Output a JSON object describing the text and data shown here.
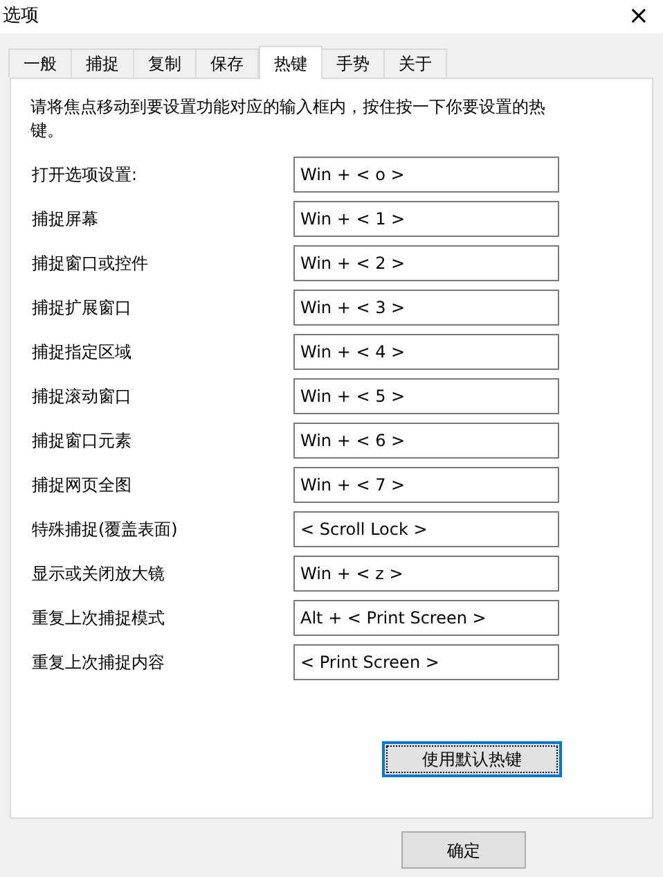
{
  "window": {
    "title": "选项",
    "close": "×"
  },
  "tabs": [
    {
      "label": "一般",
      "selected": false
    },
    {
      "label": "捕捉",
      "selected": false
    },
    {
      "label": "复制",
      "selected": false
    },
    {
      "label": "保存",
      "selected": false
    },
    {
      "label": "热键",
      "selected": true
    },
    {
      "label": "手势",
      "selected": false
    },
    {
      "label": "关于",
      "selected": false
    }
  ],
  "instructions": "请将焦点移动到要设置功能对应的输入框内，按住按一下你要设置的热键。",
  "hotkeys": [
    {
      "label": "打开选项设置:",
      "value": "Win + < o >"
    },
    {
      "label": "捕捉屏幕",
      "value": "Win + < 1 >"
    },
    {
      "label": "捕捉窗口或控件",
      "value": "Win + < 2 >"
    },
    {
      "label": "捕捉扩展窗口",
      "value": "Win + < 3 >"
    },
    {
      "label": "捕捉指定区域",
      "value": "Win + < 4 >"
    },
    {
      "label": "捕捉滚动窗口",
      "value": "Win + < 5 >"
    },
    {
      "label": "捕捉窗口元素",
      "value": "Win + < 6 >"
    },
    {
      "label": "捕捉网页全图",
      "value": "Win + < 7 >"
    },
    {
      "label": "特殊捕捉(覆盖表面)",
      "value": "< Scroll Lock >"
    },
    {
      "label": "显示或关闭放大镜",
      "value": "Win + < z >"
    },
    {
      "label": "重复上次捕捉模式",
      "value": "Alt + < Print Screen >"
    },
    {
      "label": "重复上次捕捉内容",
      "value": "< Print Screen >"
    }
  ],
  "default_button": "使用默认热键",
  "ok_button": "确定"
}
